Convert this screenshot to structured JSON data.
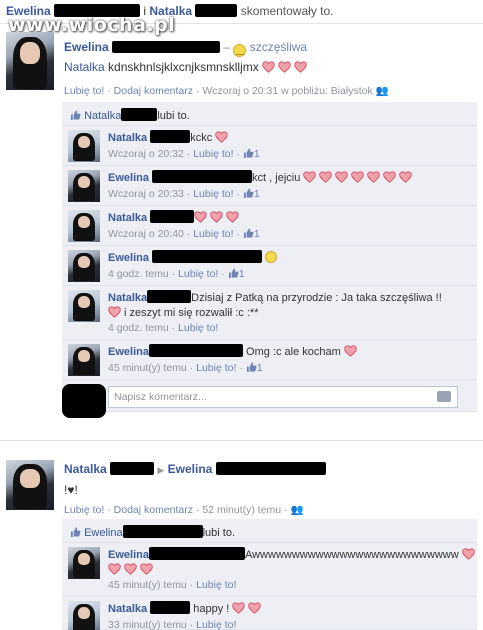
{
  "header": {
    "name1": "Ewelina",
    "joiner": "i",
    "name2": "Natalka",
    "suffix": "skomentowały to."
  },
  "watermark": "www.wiocha.pl",
  "post1": {
    "author": "Ewelina",
    "dash": "–",
    "feeling": "szczęśliwa",
    "tag": "Natalka",
    "text": "kdnskhnlsjklxcnjksmnsklljmx",
    "hearts": 3,
    "meta": {
      "like": "Lubię to!",
      "comment": "Dodaj komentarz",
      "time": "Wczoraj o 20:31 w pobliżu: Białystok"
    },
    "likes_name": "Natalka",
    "likes_suffix": "lubi to.",
    "comments": [
      {
        "author": "Natalka",
        "text": "kckc",
        "hearts_after": 1,
        "time": "Wczoraj o 20:32",
        "like": "Lubię to!",
        "count": "1"
      },
      {
        "author": "Ewelina",
        "text": "kct , jejciu",
        "hearts_after": 7,
        "time": "Wczoraj o 20:33",
        "like": "Lubię to!",
        "count": "1"
      },
      {
        "author": "Natalka",
        "text": "",
        "hearts_after": 3,
        "time": "Wczoraj o 20:40",
        "like": "Lubię to!",
        "count": "1"
      },
      {
        "author": "Ewelina",
        "text": "",
        "time": "4 godz. temu",
        "like": "Lubię to!",
        "count": "1"
      },
      {
        "author": "Natalka",
        "text": "Dzisiaj z Patką na przyrodzie : Ja taka szczęśliwa !!",
        "text2": "i zeszyt mi się rozwalił :c :**",
        "time": "4 godz. temu",
        "like": "Lubię to!"
      },
      {
        "author": "Ewelina",
        "text": "Omg :c ale kocham",
        "hearts_after": 1,
        "time": "45 minut(y) temu",
        "like": "Lubię to!",
        "count": "1"
      }
    ],
    "comment_placeholder": "Napisz komentarz..."
  },
  "post2": {
    "author": "Natalka",
    "arrow": "▶",
    "target": "Ewelina",
    "text": "!♥!",
    "meta": {
      "like": "Lubię to!",
      "comment": "Dodaj komentarz",
      "time": "52 minut(y) temu"
    },
    "likes_name": "Ewelina",
    "likes_suffix": "lubi to.",
    "comments": [
      {
        "author": "Ewelina",
        "text": "Awwwwwwwwwwwwwwwwwwwwwwwwww",
        "time": "45 minut(y) temu",
        "like": "Lubię to!"
      },
      {
        "author": "Natalka",
        "text": "happy !",
        "time": "33 minut(y) temu",
        "like": "Lubię to!"
      }
    ]
  },
  "colors": {
    "link": "#3b5998",
    "meta": "#90949c",
    "heart": "#e8596a",
    "comment_bg": "#edeff4"
  }
}
